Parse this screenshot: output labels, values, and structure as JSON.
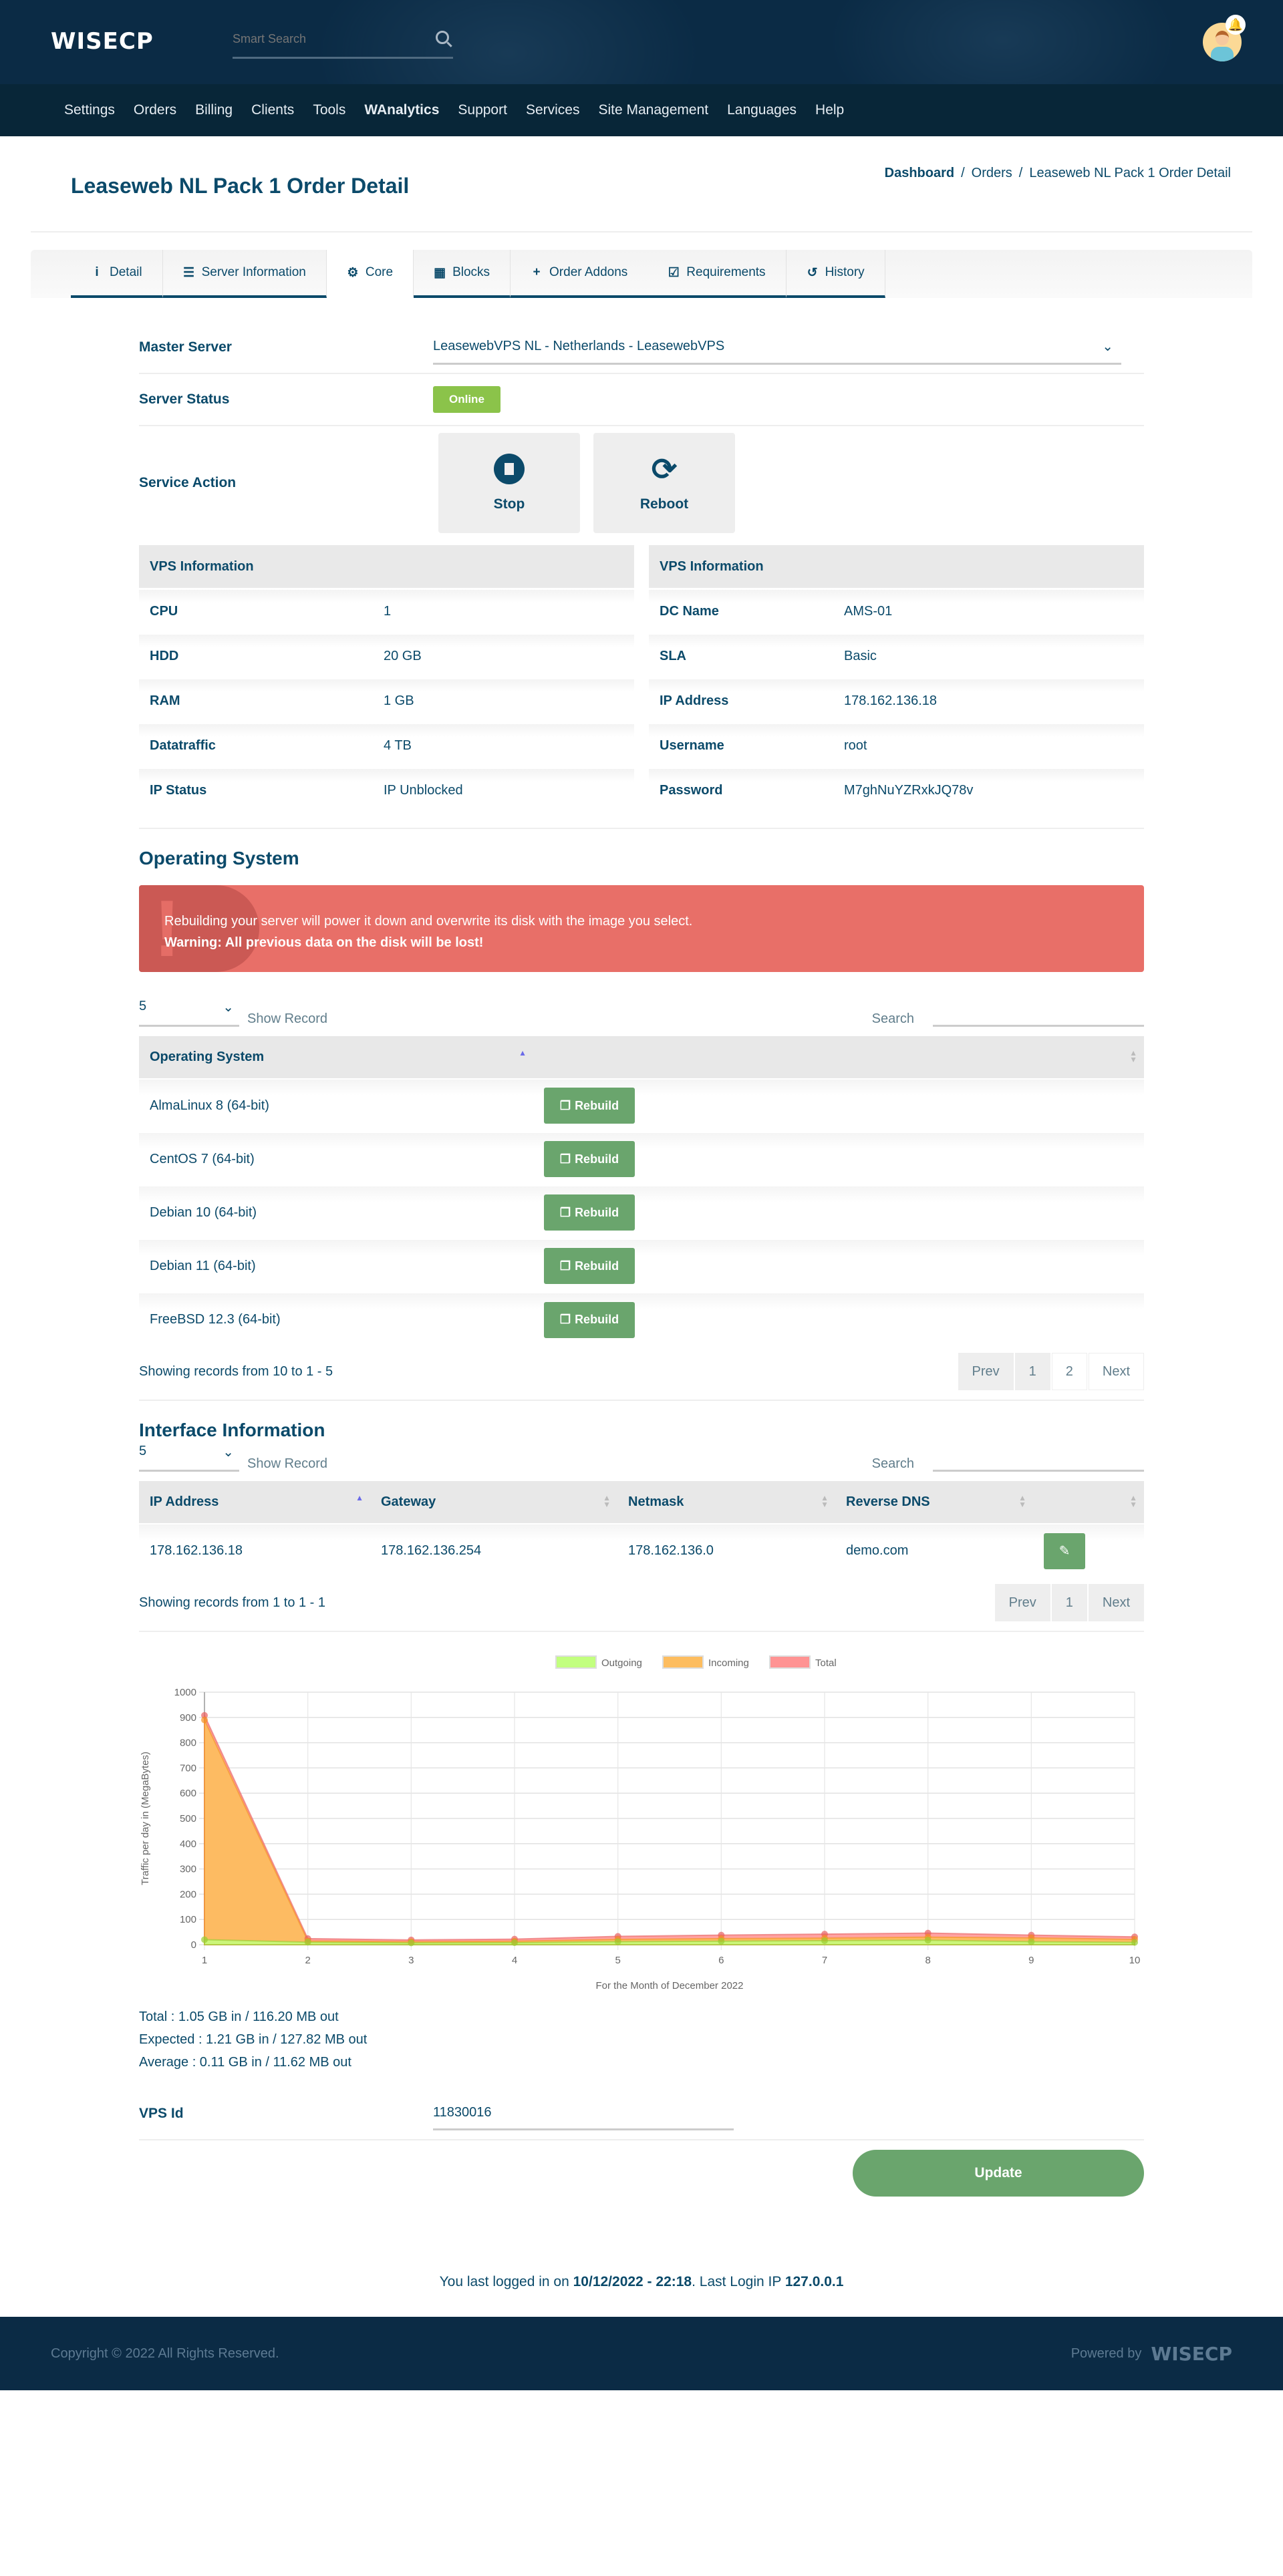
{
  "header": {
    "logo": "WISECP",
    "search_placeholder": "Smart Search",
    "notification_icon": "bell-icon"
  },
  "nav": [
    {
      "label": "Settings"
    },
    {
      "label": "Orders"
    },
    {
      "label": "Billing"
    },
    {
      "label": "Clients"
    },
    {
      "label": "Tools"
    },
    {
      "label": "WAnalytics"
    },
    {
      "label": "Support"
    },
    {
      "label": "Services"
    },
    {
      "label": "Site Management"
    },
    {
      "label": "Languages"
    },
    {
      "label": "Help"
    }
  ],
  "page": {
    "title": "Leaseweb NL Pack 1 Order Detail",
    "breadcrumb": [
      "Dashboard",
      "Orders",
      "Leaseweb NL Pack 1 Order Detail"
    ]
  },
  "tabs": [
    {
      "label": "Detail",
      "icon": "info-icon",
      "glyph": "i"
    },
    {
      "label": "Server Information",
      "icon": "server-icon",
      "glyph": "☰"
    },
    {
      "label": "Core",
      "icon": "cogs-icon",
      "glyph": "⚙",
      "active": true
    },
    {
      "label": "Blocks",
      "icon": "blocks-icon",
      "glyph": "▦"
    },
    {
      "label": "Order Addons",
      "icon": "plus-icon",
      "glyph": "+"
    },
    {
      "label": "Requirements",
      "icon": "checkbox-icon",
      "glyph": "☑"
    },
    {
      "label": "History",
      "icon": "history-icon",
      "glyph": "↺"
    }
  ],
  "core": {
    "master_server_label": "Master Server",
    "master_server_value": "LeasewebVPS NL - Netherlands - LeasewebVPS",
    "server_status_label": "Server Status",
    "server_status_value": "Online",
    "service_action_label": "Service Action",
    "actions": [
      {
        "label": "Stop"
      },
      {
        "label": "Reboot"
      }
    ]
  },
  "vps_info": {
    "left": {
      "title": "VPS Information",
      "rows": [
        {
          "k": "CPU",
          "v": "1"
        },
        {
          "k": "HDD",
          "v": "20 GB"
        },
        {
          "k": "RAM",
          "v": "1 GB"
        },
        {
          "k": "Datatraffic",
          "v": "4 TB"
        },
        {
          "k": "IP Status",
          "v": "IP Unblocked"
        }
      ]
    },
    "right": {
      "title": "VPS Information",
      "rows": [
        {
          "k": "DC Name",
          "v": "AMS-01"
        },
        {
          "k": "SLA",
          "v": "Basic"
        },
        {
          "k": "IP Address",
          "v": "178.162.136.18"
        },
        {
          "k": "Username",
          "v": "root"
        },
        {
          "k": "Password",
          "v": "M7ghNuYZRxkJQ78v"
        }
      ]
    }
  },
  "os": {
    "title": "Operating System",
    "alert_line1": "Rebuilding your server will power it down and overwrite its disk with the image you select.",
    "alert_line2": "Warning: All previous data on the disk will be lost!",
    "length_value": "5",
    "show_record": "Show Record",
    "search_label": "Search",
    "column": "Operating System",
    "rebuild_label": "Rebuild",
    "rows": [
      {
        "name": "AlmaLinux 8 (64-bit)"
      },
      {
        "name": "CentOS 7 (64-bit)"
      },
      {
        "name": "Debian 10 (64-bit)"
      },
      {
        "name": "Debian 11 (64-bit)"
      },
      {
        "name": "FreeBSD 12.3 (64-bit)"
      }
    ],
    "info": "Showing records from 10 to 1 - 5",
    "pager": [
      "Prev",
      "1",
      "2",
      "Next"
    ]
  },
  "iface": {
    "title": "Interface Information",
    "length_value": "5",
    "show_record": "Show Record",
    "search_label": "Search",
    "columns": [
      "IP Address",
      "Gateway",
      "Netmask",
      "Reverse DNS"
    ],
    "rows": [
      {
        "ip": "178.162.136.18",
        "gateway": "178.162.136.254",
        "netmask": "178.162.136.0",
        "rdns": "demo.com"
      }
    ],
    "info": "Showing records from 1 to 1 - 1",
    "pager": [
      "Prev",
      "1",
      "Next"
    ]
  },
  "chart_data": {
    "type": "area",
    "title": "",
    "xlabel": "For the Month of December 2022",
    "ylabel": "Traffic per day in (MegaBytes)",
    "x": [
      1,
      2,
      3,
      4,
      5,
      6,
      7,
      8,
      9,
      10
    ],
    "ylim": [
      0,
      1000
    ],
    "yticks": [
      0,
      100,
      200,
      300,
      400,
      500,
      600,
      700,
      800,
      900,
      1000
    ],
    "grid": true,
    "legend_position": "top-center",
    "series": [
      {
        "name": "Outgoing",
        "color": "#c2ff7f",
        "stroke": "#9acd32",
        "values": [
          20,
          10,
          7,
          8,
          12,
          14,
          16,
          18,
          12,
          9
        ]
      },
      {
        "name": "Incoming",
        "color": "#fdbd5f",
        "stroke": "#f39223",
        "values": [
          890,
          15,
          12,
          14,
          21,
          24,
          26,
          30,
          27,
          21
        ]
      },
      {
        "name": "Total",
        "color": "#ff9393",
        "stroke": "#e86060",
        "values": [
          908,
          24,
          19,
          22,
          33,
          38,
          42,
          46,
          38,
          31
        ]
      }
    ]
  },
  "stats": {
    "total": "Total : 1.05 GB in / 116.20 MB out",
    "expected": "Expected : 1.21 GB in / 127.82 MB out",
    "average": "Average : 0.11 GB in / 11.62 MB out"
  },
  "vps_id": {
    "label": "VPS Id",
    "value": "11830016"
  },
  "update_label": "Update",
  "last_login": {
    "prefix": "You last logged in on ",
    "datetime": "10/12/2022 - 22:18",
    "mid": ". Last Login IP ",
    "ip": "127.0.0.1"
  },
  "footer": {
    "copyright": "Copyright © 2022 All Rights Reserved.",
    "powered": "Powered by",
    "logo": "WISECP"
  }
}
